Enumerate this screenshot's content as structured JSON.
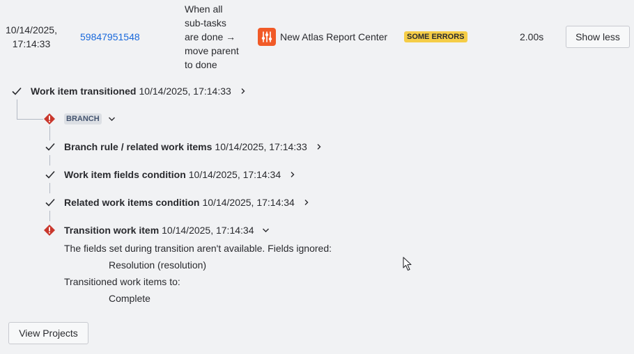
{
  "log_row": {
    "date": "10/14/2025,",
    "time": "17:14:33",
    "id": "59847951548",
    "rule_lines": [
      "When all",
      "sub-tasks",
      "are done →",
      "move parent",
      "to done"
    ],
    "project": "New Atlas Report Center",
    "status": "SOME ERRORS",
    "duration": "2.00s",
    "show_less_label": "Show less"
  },
  "trace": {
    "root": {
      "title": "Work item transitioned",
      "timestamp": "10/14/2025, 17:14:33",
      "status": "success"
    },
    "branch": {
      "label": "BRANCH",
      "status": "error"
    },
    "steps": [
      {
        "title": "Branch rule / related work items",
        "timestamp": "10/14/2025, 17:14:33",
        "status": "success"
      },
      {
        "title": "Work item fields condition",
        "timestamp": "10/14/2025, 17:14:34",
        "status": "success"
      },
      {
        "title": "Related work items condition",
        "timestamp": "10/14/2025, 17:14:34",
        "status": "success"
      },
      {
        "title": "Transition work item",
        "timestamp": "10/14/2025, 17:14:34",
        "status": "error"
      }
    ],
    "details": {
      "message1": "The fields set during transition aren't available. Fields ignored:",
      "value1": "Resolution (resolution)",
      "message2": "Transitioned work items to:",
      "value2": "Complete"
    }
  },
  "footer": {
    "view_projects_label": "View Projects"
  },
  "colors": {
    "error": "#c9372c",
    "warning_badge": "#f5cd47",
    "link": "#1868db",
    "project_icon": "#f15a27"
  }
}
